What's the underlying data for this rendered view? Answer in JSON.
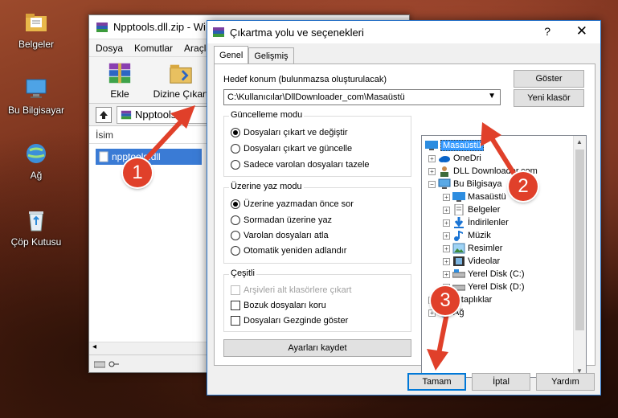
{
  "desktop": {
    "icons": [
      {
        "label": "Belgeler",
        "icon": "folder-documents-icon"
      },
      {
        "label": "Bu Bilgisayar",
        "icon": "computer-icon"
      },
      {
        "label": "Ağ",
        "icon": "network-icon"
      },
      {
        "label": "Çöp Kutusu",
        "icon": "recycle-bin-icon"
      }
    ]
  },
  "back_window": {
    "title": "Npptools.dll.zip - Wi",
    "menu": [
      "Dosya",
      "Komutlar",
      "Araçla"
    ],
    "toolbar": [
      "Ekle",
      "Dizine Çıkart"
    ],
    "address": "Npptools.dll",
    "column_header": "İsim",
    "row": "npptools.dll"
  },
  "dialog": {
    "title": "Çıkartma yolu ve seçenekleri",
    "help": "?",
    "close": "✕",
    "tabs": [
      "Genel",
      "Gelişmiş"
    ],
    "dest_label": "Hedef konum (bulunmazsa oluşturulacak)",
    "dest_value": "C:\\Kullanıcılar\\DllDownloader_com\\Masaüstü",
    "show_button": "Göster",
    "new_folder_button": "Yeni klasör",
    "update_mode": {
      "title": "Güncelleme modu",
      "options": [
        "Dosyaları çıkart ve değiştir",
        "Dosyaları çıkart ve güncelle",
        "Sadece varolan dosyaları tazele"
      ],
      "selected": 0
    },
    "overwrite_mode": {
      "title": "Üzerine yaz modu",
      "options": [
        "Üzerine yazmadan önce sor",
        "Sormadan üzerine yaz",
        "Varolan dosyaları atla",
        "Otomatik yeniden adlandır"
      ],
      "selected": 0
    },
    "misc": {
      "title": "Çeşitli",
      "options": [
        "Arşivleri alt klasörlere çıkart",
        "Bozuk dosyaları koru",
        "Dosyaları Gezginde göster"
      ],
      "disabled": [
        true,
        false,
        false
      ]
    },
    "save_settings_button": "Ayarları kaydet",
    "tree": [
      {
        "label": "Masaüstü",
        "level": 0,
        "icon": "desktop-icon",
        "selected": true
      },
      {
        "label": "OneDri",
        "level": 1,
        "icon": "onedrive-icon"
      },
      {
        "label": "DLL Downloader.com",
        "level": 1,
        "icon": "user-icon"
      },
      {
        "label": "Bu Bilgisaya",
        "level": 1,
        "icon": "computer-icon",
        "expanded": true
      },
      {
        "label": "Masaüstü",
        "level": 2,
        "icon": "desktop-icon"
      },
      {
        "label": "Belgeler",
        "level": 2,
        "icon": "documents-icon"
      },
      {
        "label": "İndirilenler",
        "level": 2,
        "icon": "downloads-icon"
      },
      {
        "label": "Müzik",
        "level": 2,
        "icon": "music-icon"
      },
      {
        "label": "Resimler",
        "level": 2,
        "icon": "pictures-icon"
      },
      {
        "label": "Videolar",
        "level": 2,
        "icon": "videos-icon"
      },
      {
        "label": "Yerel Disk (C:)",
        "level": 2,
        "icon": "disk-icon"
      },
      {
        "label": "Yerel Disk (D:)",
        "level": 2,
        "icon": "disk-icon"
      },
      {
        "label": "Kitaplıklar",
        "level": 1,
        "icon": "libraries-icon"
      },
      {
        "label": "Ağ",
        "level": 1,
        "icon": "network-icon"
      }
    ],
    "buttons": {
      "ok": "Tamam",
      "cancel": "İptal",
      "help": "Yardım"
    }
  },
  "callouts": [
    "1",
    "2",
    "3"
  ],
  "colors": {
    "callout": "#e0402a",
    "selection": "#3399ff",
    "accent_border": "#0078d7"
  }
}
